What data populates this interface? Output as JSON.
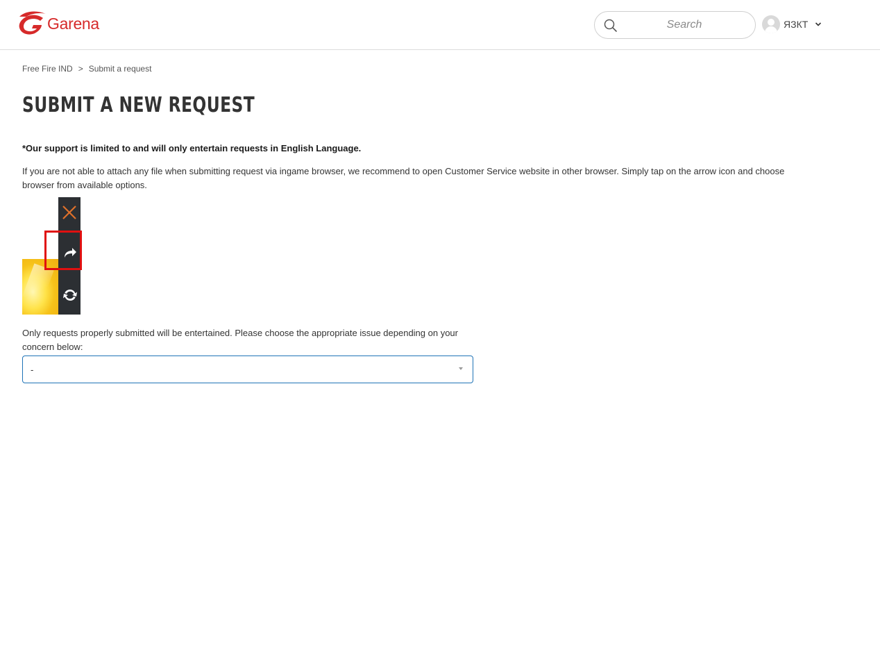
{
  "header": {
    "logo_text": "Garena",
    "brand_color": "#d62a2a",
    "search_placeholder": "Search",
    "user_name": "ЯЗКТ"
  },
  "breadcrumb": {
    "items": [
      "Free Fire IND",
      "Submit a request"
    ],
    "separator": ">"
  },
  "page": {
    "title": "SUBMIT A NEW REQUEST",
    "notice_bold": "*Our support is limited to and will only entertain requests in English Language.",
    "notice_text": "If you are not able to attach any file when submitting request via ingame browser, we recommend to open Customer Service website in other browser. Simply tap on the arrow icon and choose browser from available options.",
    "concern_text": "Only requests properly submitted will be entertained. Please choose the appropriate issue depending on your concern below:",
    "issue_select": {
      "selected": "-"
    }
  },
  "instruction_image": {
    "icons": [
      "close-icon",
      "share-arrow-icon",
      "refresh-icon"
    ],
    "highlight_color": "#e01010"
  }
}
